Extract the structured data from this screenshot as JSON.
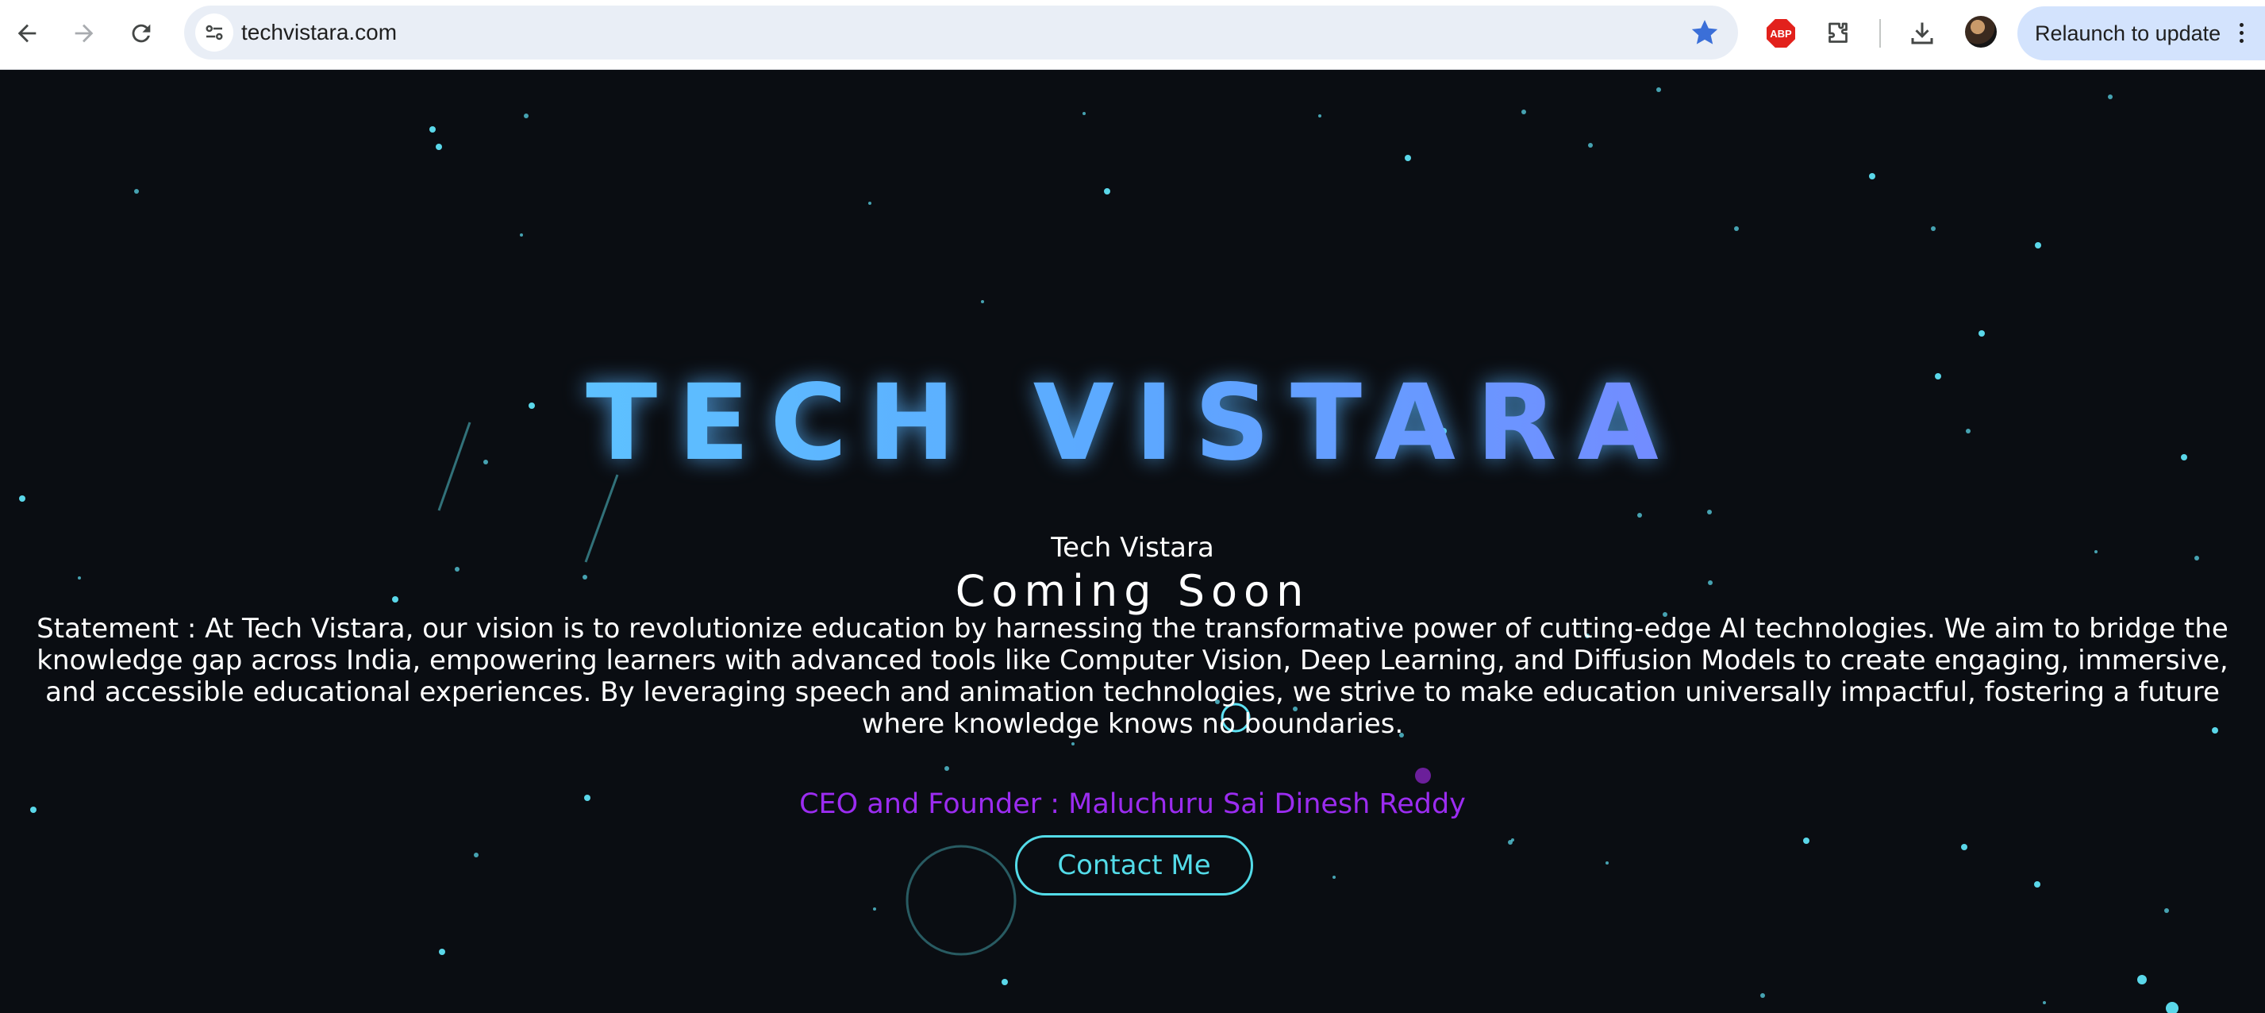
{
  "browser": {
    "url": "techvistara.com",
    "relaunch_label": "Relaunch to update",
    "adblock_label": "ABP",
    "icons": [
      "back-arrow-icon",
      "forward-arrow-icon",
      "reload-icon",
      "site-info-icon",
      "bookmark-star-icon",
      "adblock-icon",
      "extensions-icon",
      "download-icon",
      "avatar",
      "more-menu-icon"
    ]
  },
  "page": {
    "hero_title": "TECH VISTARA",
    "brand": "Tech Vistara",
    "coming_soon": "Coming Soon",
    "statement": "Statement : At Tech Vistara, our vision is to revolutionize education by harnessing the transformative power of cutting-edge AI technologies. We aim to bridge the knowledge gap across India, empowering learners with advanced tools like Computer Vision, Deep Learning, and Diffusion Models to create engaging, immersive, and accessible educational experiences. By leveraging speech and animation technologies, we strive to make education universally impactful, fostering a future where knowledge knows no boundaries.",
    "ceo": "CEO and Founder : Maluchuru Sai Dinesh Reddy",
    "contact_label": "Contact Me"
  },
  "colors": {
    "background": "#0a0d12",
    "star": "#5fe3f5",
    "title_gradient": [
      "#5fdcff",
      "#5ca8ff",
      "#8c6cff"
    ],
    "ceo": "#9b2cf0",
    "contact_accent": "#53dbe8",
    "omnibox": "#e9eef6",
    "relaunch_bg": "#d3e3fd",
    "bookmark_star": "#3b6fd8"
  }
}
